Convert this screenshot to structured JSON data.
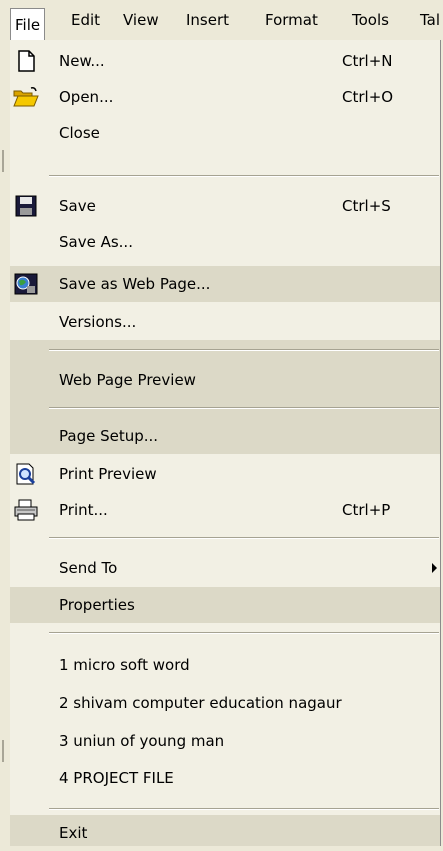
{
  "menubar": {
    "items": [
      "File",
      "Edit",
      "View",
      "Insert",
      "Format",
      "Tools",
      "Tal"
    ]
  },
  "menu": {
    "new": {
      "label": "New...",
      "shortcut": "Ctrl+N",
      "icon": "new-document-icon"
    },
    "open": {
      "label": "Open...",
      "shortcut": "Ctrl+O",
      "icon": "open-folder-icon"
    },
    "close": {
      "label": "Close"
    },
    "save": {
      "label": "Save",
      "shortcut": "Ctrl+S",
      "icon": "save-floppy-icon"
    },
    "save_as": {
      "label": "Save As..."
    },
    "save_web": {
      "label": "Save as Web Page...",
      "icon": "web-page-icon"
    },
    "versions": {
      "label": "Versions..."
    },
    "web_preview": {
      "label": "Web Page Preview"
    },
    "page_setup": {
      "label": "Page Setup..."
    },
    "print_preview": {
      "label": "Print Preview",
      "icon": "print-preview-icon"
    },
    "print": {
      "label": "Print...",
      "shortcut": "Ctrl+P",
      "icon": "printer-icon"
    },
    "send_to": {
      "label": "Send To"
    },
    "properties": {
      "label": "Properties"
    },
    "recent": [
      "1 micro soft word",
      "2 shivam computer education nagaur",
      "3 uniun of young man",
      "4 PROJECT FILE"
    ],
    "exit": {
      "label": "Exit"
    }
  },
  "colors": {
    "menu_bg": "#f2f0e4",
    "shaded_bg": "#dcd9c7",
    "menubar_bg": "#ece9d8"
  }
}
